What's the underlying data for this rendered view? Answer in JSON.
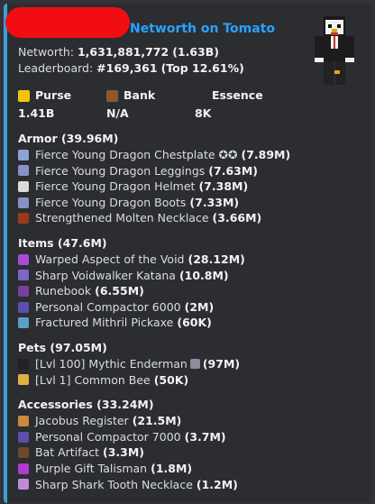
{
  "header": {
    "title": "Networth on Tomato"
  },
  "stats": {
    "networth_label": "Networth:",
    "networth_value": "1,631,881,772",
    "networth_short": "(1.63B)",
    "leaderboard_label": "Leaderboard:",
    "leaderboard_value": "#169,361",
    "leaderboard_top": "(Top 12.61%)"
  },
  "fields": [
    {
      "name": "Purse",
      "value": "1.41B",
      "icon": "gold-ingot-icon",
      "color": "#f1c40f"
    },
    {
      "name": "Bank",
      "value": "N/A",
      "icon": "chest-icon",
      "color": "#8b5a2b"
    },
    {
      "name": "Essence",
      "value": "8K",
      "icon": "essence-icon",
      "color": "#2c2c2c"
    }
  ],
  "sections": [
    {
      "title": "Armor (39.96M)",
      "items": [
        {
          "name": "Fierce Young Dragon Chestplate",
          "suffix": "✪✪",
          "value": "(7.89M)",
          "icon": "chestplate-icon",
          "color": "#8fa2d8"
        },
        {
          "name": "Fierce Young Dragon Leggings",
          "value": "(7.63M)",
          "icon": "leggings-icon",
          "color": "#8a90c8"
        },
        {
          "name": "Fierce Young Dragon Helmet",
          "value": "(7.38M)",
          "icon": "helmet-icon",
          "color": "#d9d9d9"
        },
        {
          "name": "Fierce Young Dragon Boots",
          "value": "(7.33M)",
          "icon": "boots-icon",
          "color": "#8a90c8"
        },
        {
          "name": "Strengthened Molten Necklace",
          "value": "(3.66M)",
          "icon": "necklace-icon",
          "color": "#9b3a1a"
        }
      ]
    },
    {
      "title": "Items (47.6M)",
      "items": [
        {
          "name": "Warped Aspect of the Void",
          "value": "(28.12M)",
          "icon": "sword-icon",
          "color": "#a84cd9"
        },
        {
          "name": "Sharp Voidwalker Katana",
          "value": "(10.8M)",
          "icon": "katana-icon",
          "color": "#7d66c9"
        },
        {
          "name": "Runebook",
          "value": "(6.55M)",
          "icon": "book-icon",
          "color": "#7b3fa0"
        },
        {
          "name": "Personal Compactor 6000",
          "value": "(2M)",
          "icon": "compactor-icon",
          "color": "#5a4fb0"
        },
        {
          "name": "Fractured Mithril Pickaxe",
          "value": "(60K)",
          "icon": "pickaxe-icon",
          "color": "#5aa0c8"
        }
      ]
    },
    {
      "title": "Pets (97.05M)",
      "items": [
        {
          "name": "[Lvl 100] Mythic Enderman",
          "suffix_icon": "enderman-cube-icon",
          "value": "(97M)",
          "icon": "enderman-icon",
          "color": "#222222"
        },
        {
          "name": "[Lvl 1] Common Bee",
          "value": "(50K)",
          "icon": "bee-icon",
          "color": "#e0b040"
        }
      ]
    },
    {
      "title": "Accessories (33.24M)",
      "items": [
        {
          "name": "Jacobus Register",
          "value": "(21.5M)",
          "icon": "register-icon",
          "color": "#c98a3a"
        },
        {
          "name": "Personal Compactor 7000",
          "value": "(3.7M)",
          "icon": "compactor-icon",
          "color": "#5a4fb0"
        },
        {
          "name": "Bat Artifact",
          "value": "(3.3M)",
          "icon": "bat-icon",
          "color": "#6b4a2a"
        },
        {
          "name": "Purple Gift Talisman",
          "value": "(1.8M)",
          "icon": "gift-icon",
          "color": "#b03ad0"
        },
        {
          "name": "Sharp Shark Tooth Necklace",
          "value": "(1.2M)",
          "icon": "tooth-icon",
          "color": "#c08ad8"
        }
      ]
    }
  ],
  "colors": {
    "accent": "#3aa0d8",
    "title": "#2aa2ff",
    "redaction": "#f20d12"
  }
}
